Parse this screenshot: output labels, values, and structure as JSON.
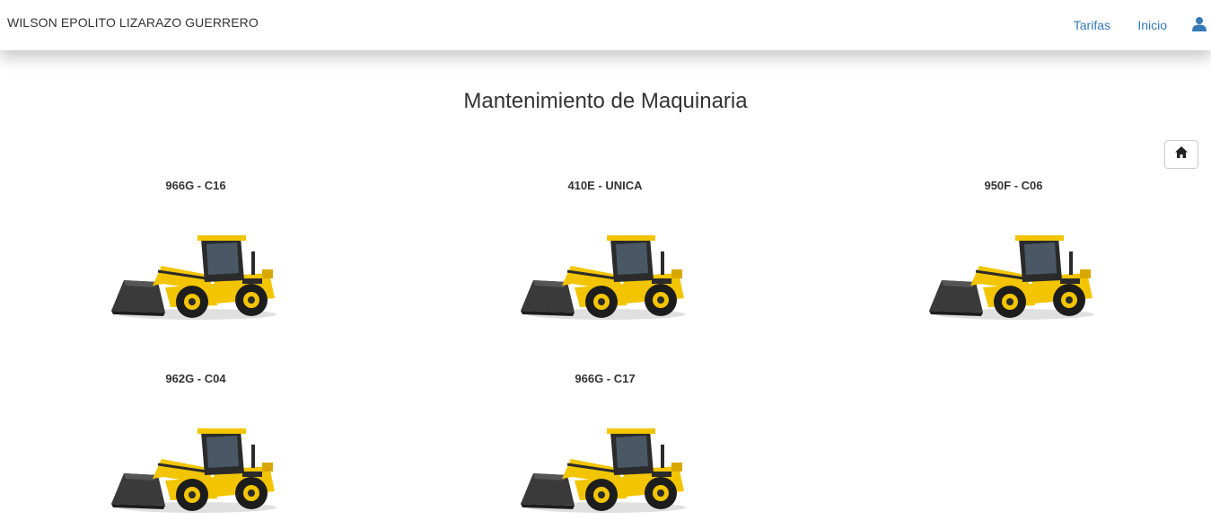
{
  "navbar": {
    "brand": "WILSON EPOLITO LIZARAZO GUERRERO",
    "links": [
      {
        "label": "Tarifas"
      },
      {
        "label": "Inicio"
      }
    ],
    "user_icon": "user-icon",
    "link_color": "#337ab7"
  },
  "page": {
    "title": "Mantenimiento de Maquinaria",
    "home_icon": "home-icon"
  },
  "machines": [
    {
      "title": "966G - C16",
      "image": "wheel-loader-image"
    },
    {
      "title": "410E - UNICA",
      "image": "wheel-loader-image"
    },
    {
      "title": "950F - C06",
      "image": "wheel-loader-image"
    },
    {
      "title": "962G - C04",
      "image": "wheel-loader-image"
    },
    {
      "title": "966G - C17",
      "image": "wheel-loader-image"
    }
  ],
  "colors": {
    "machine_body": "#f2c500",
    "machine_dark": "#2b2b2b"
  }
}
